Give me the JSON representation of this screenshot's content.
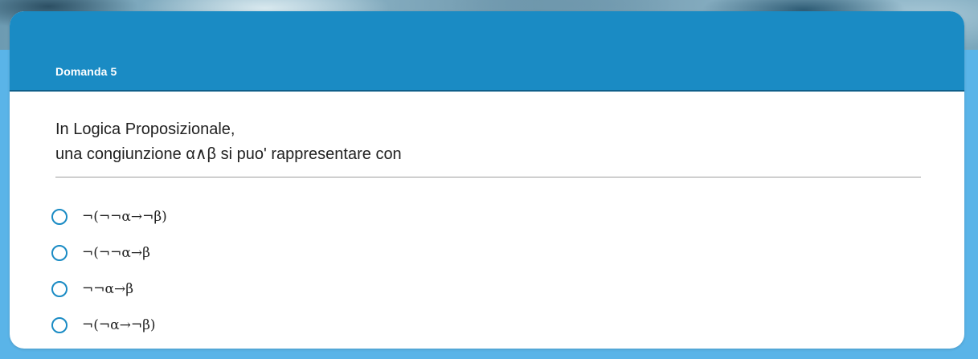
{
  "header": {
    "title": "Domanda 5"
  },
  "question": {
    "line1": "In Logica Proposizionale,",
    "line2": "una congiunzione α∧β si puo' rappresentare con"
  },
  "options": [
    {
      "label": "¬(¬¬α→¬β)"
    },
    {
      "label": "¬(¬¬α→β"
    },
    {
      "label": "¬¬α→β"
    },
    {
      "label": "¬(¬α→¬β)"
    }
  ],
  "colors": {
    "accent": "#1a8bc4",
    "page_background": "#5ab4e8",
    "header_border": "#0f5f8a"
  }
}
